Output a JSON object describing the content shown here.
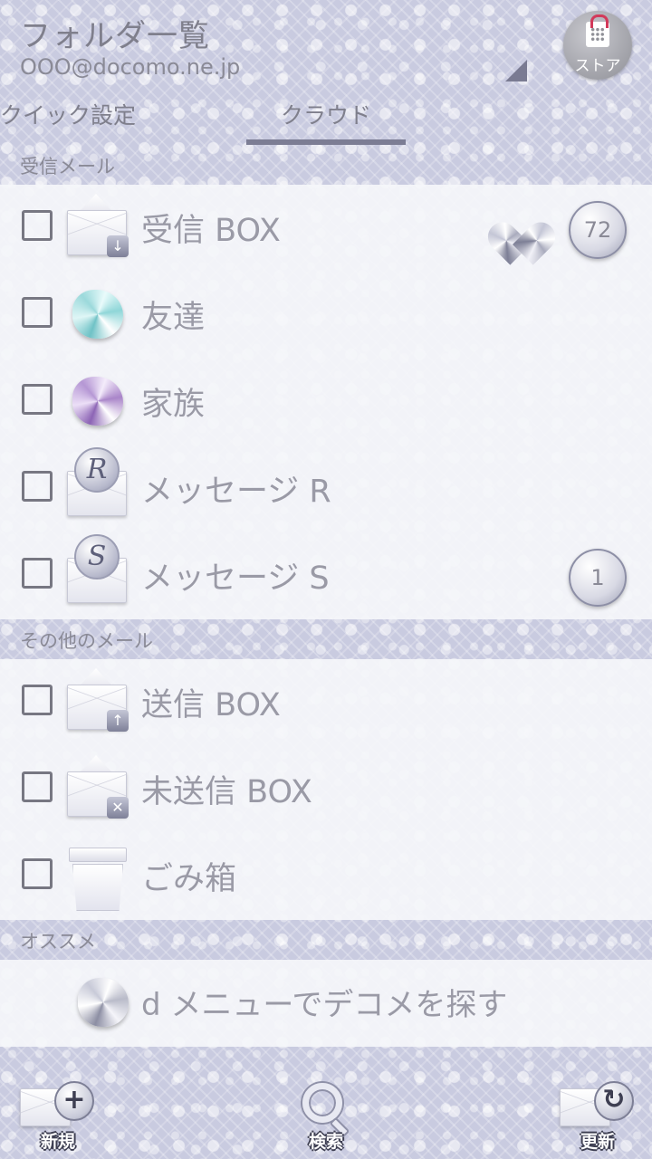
{
  "header": {
    "title": "フォルダ一覧",
    "account": "OOO@docomo.ne.jp",
    "store_label": "ストア"
  },
  "tabs": [
    {
      "label": "クイック設定",
      "selected": false
    },
    {
      "label": "クラウド",
      "selected": true
    }
  ],
  "sections": {
    "inbox_label": "受信メール",
    "other_label": "その他のメール",
    "recommend_label": "オススメ"
  },
  "inbox_folders": [
    {
      "label": "受信 BOX",
      "icon": "inbox-envelope-icon",
      "count": "72",
      "heart": true
    },
    {
      "label": "友達",
      "icon": "teal-gem-icon"
    },
    {
      "label": "家族",
      "icon": "purple-gem-icon"
    },
    {
      "label": "メッセージ R",
      "icon": "message-r-icon",
      "coin": "R"
    },
    {
      "label": "メッセージ S",
      "icon": "message-s-icon",
      "coin": "S",
      "count": "1"
    }
  ],
  "other_folders": [
    {
      "label": "送信 BOX",
      "icon": "outbox-envelope-icon",
      "arrow": "↑"
    },
    {
      "label": "未送信 BOX",
      "icon": "unsent-envelope-icon",
      "arrow": "✕"
    },
    {
      "label": "ごみ箱",
      "icon": "trash-icon"
    }
  ],
  "recommend": {
    "text": "d メニューでデコメを探す"
  },
  "toolbar": {
    "new_label": "新規",
    "search_label": "検索",
    "refresh_label": "更新",
    "new_symbol": "+",
    "refresh_symbol": "↻"
  },
  "colors": {
    "accent": "#7c7d94",
    "text": "#9a9aa6",
    "trash_lid_handle": "#d23a5a"
  }
}
